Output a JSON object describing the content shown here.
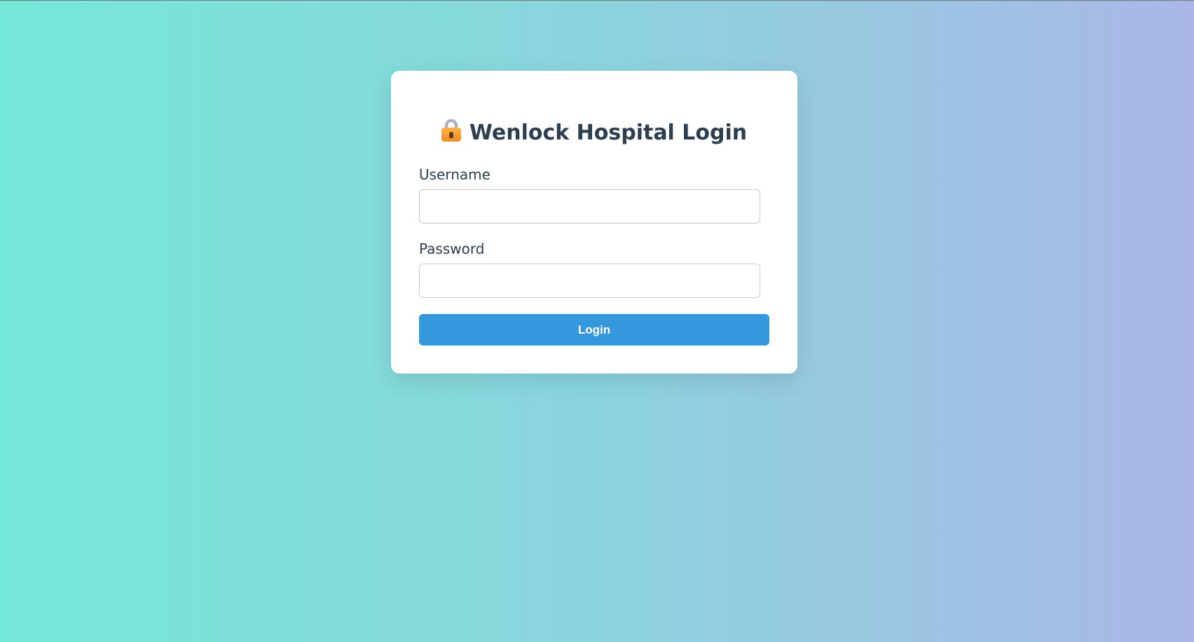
{
  "page": {
    "background_colors": [
      "#76e8d7",
      "#8bd4dc",
      "#aab7e6"
    ]
  },
  "login_card": {
    "title": "Wenlock Hospital Login",
    "title_icon": "lock-with-key-icon",
    "username_label": "Username",
    "username_value": "",
    "username_placeholder": "",
    "password_label": "Password",
    "password_value": "",
    "password_placeholder": "",
    "login_button_label": "Login",
    "accent_color": "#3598dc",
    "title_color": "#2c3e50"
  }
}
